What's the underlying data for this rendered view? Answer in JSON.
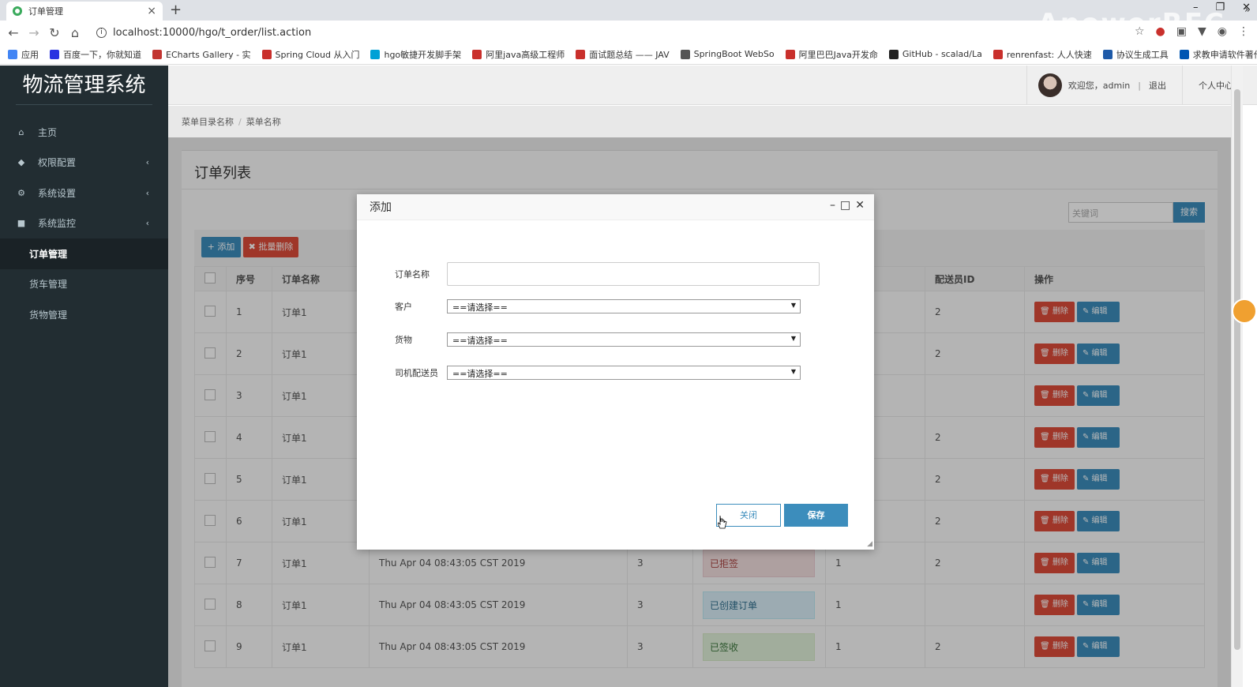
{
  "browser": {
    "tab_title": "订单管理",
    "url": "localhost:10000/hgo/t_order/list.action",
    "watermark": "ApowerREC",
    "bookmarks": [
      {
        "label": "应用",
        "color": "#4285f4"
      },
      {
        "label": "百度一下，你就知道",
        "color": "#2932e1"
      },
      {
        "label": "ECharts Gallery - 实",
        "color": "#c23531"
      },
      {
        "label": "Spring Cloud 从入门",
        "color": "#c9302c"
      },
      {
        "label": "hgo敏捷开发脚手架",
        "color": "#00a1d6"
      },
      {
        "label": "阿里java高级工程师",
        "color": "#c9302c"
      },
      {
        "label": "面试题总结 —— JAV",
        "color": "#c9302c"
      },
      {
        "label": "SpringBoot WebSo",
        "color": "#555555"
      },
      {
        "label": "阿里巴巴Java开发命",
        "color": "#c9302c"
      },
      {
        "label": "GitHub - scalad/La",
        "color": "#222222"
      },
      {
        "label": "renrenfast: 人人快速",
        "color": "#c9302c"
      },
      {
        "label": "协议生成工具",
        "color": "#1e5aa8"
      },
      {
        "label": "求教申请软件著作权",
        "color": "#0056b3"
      }
    ]
  },
  "app": {
    "title": "物流管理系统",
    "menu": [
      {
        "label": "主页",
        "icon": "home-icon",
        "glyph": "⌂",
        "arrow": false,
        "sub": false,
        "active": false
      },
      {
        "label": "权限配置",
        "icon": "shield-icon",
        "glyph": "◆",
        "arrow": true,
        "sub": false,
        "active": false
      },
      {
        "label": "系统设置",
        "icon": "gears-icon",
        "glyph": "⚙",
        "arrow": true,
        "sub": false,
        "active": false
      },
      {
        "label": "系统监控",
        "icon": "video-icon",
        "glyph": "■",
        "arrow": true,
        "sub": false,
        "active": false
      },
      {
        "label": "订单管理",
        "icon": "",
        "glyph": "",
        "arrow": false,
        "sub": true,
        "active": true
      },
      {
        "label": "货车管理",
        "icon": "",
        "glyph": "",
        "arrow": false,
        "sub": true,
        "active": false
      },
      {
        "label": "货物管理",
        "icon": "",
        "glyph": "",
        "arrow": false,
        "sub": true,
        "active": false
      }
    ],
    "header": {
      "welcome": "欢迎您，admin",
      "logout": "退出",
      "profile": "个人中心"
    },
    "breadcrumb": {
      "root": "菜单目录名称",
      "current": "菜单名称"
    }
  },
  "panel": {
    "title": "订单列表",
    "search_placeholder": "关键词",
    "search_label": "搜索",
    "add_label": "+ 添加",
    "batch_delete_label": "✖ 批量删除",
    "columns": [
      "序号",
      "订单名称",
      "",
      "",
      "",
      "",
      "配送员ID",
      "操作"
    ],
    "rows": [
      {
        "no": "1",
        "name": "订单1",
        "time": "",
        "c": "",
        "status": "",
        "status_type": "",
        "d": "",
        "courier": "2"
      },
      {
        "no": "2",
        "name": "订单1",
        "time": "",
        "c": "",
        "status": "",
        "status_type": "",
        "d": "",
        "courier": "2"
      },
      {
        "no": "3",
        "name": "订单1",
        "time": "",
        "c": "",
        "status": "",
        "status_type": "",
        "d": "",
        "courier": ""
      },
      {
        "no": "4",
        "name": "订单1",
        "time": "",
        "c": "",
        "status": "",
        "status_type": "",
        "d": "",
        "courier": "2"
      },
      {
        "no": "5",
        "name": "订单1",
        "time": "",
        "c": "",
        "status": "",
        "status_type": "",
        "d": "",
        "courier": "2"
      },
      {
        "no": "6",
        "name": "订单1",
        "time": "",
        "c": "",
        "status": "",
        "status_type": "",
        "d": "",
        "courier": "2"
      },
      {
        "no": "7",
        "name": "订单1",
        "time": "Thu Apr 04 08:43:05 CST 2019",
        "c": "3",
        "status": "已拒签",
        "status_type": "reject",
        "d": "1",
        "courier": "2"
      },
      {
        "no": "8",
        "name": "订单1",
        "time": "Thu Apr 04 08:43:05 CST 2019",
        "c": "3",
        "status": "已创建订单",
        "status_type": "created",
        "d": "1",
        "courier": ""
      },
      {
        "no": "9",
        "name": "订单1",
        "time": "Thu Apr 04 08:43:05 CST 2019",
        "c": "3",
        "status": "已签收",
        "status_type": "signed",
        "d": "1",
        "courier": "2"
      }
    ],
    "delete_label": "🗑 删除",
    "edit_label": "✎ 编辑"
  },
  "modal": {
    "title": "添加",
    "fields": {
      "order_name_label": "订单名称",
      "order_name_value": "",
      "customer_label": "客户",
      "customer_value": "==请选择==",
      "goods_label": "货物",
      "goods_value": "==请选择==",
      "driver_label": "司机配送员",
      "driver_value": "==请选择=="
    },
    "close_label": "关闭",
    "save_label": "保存"
  }
}
